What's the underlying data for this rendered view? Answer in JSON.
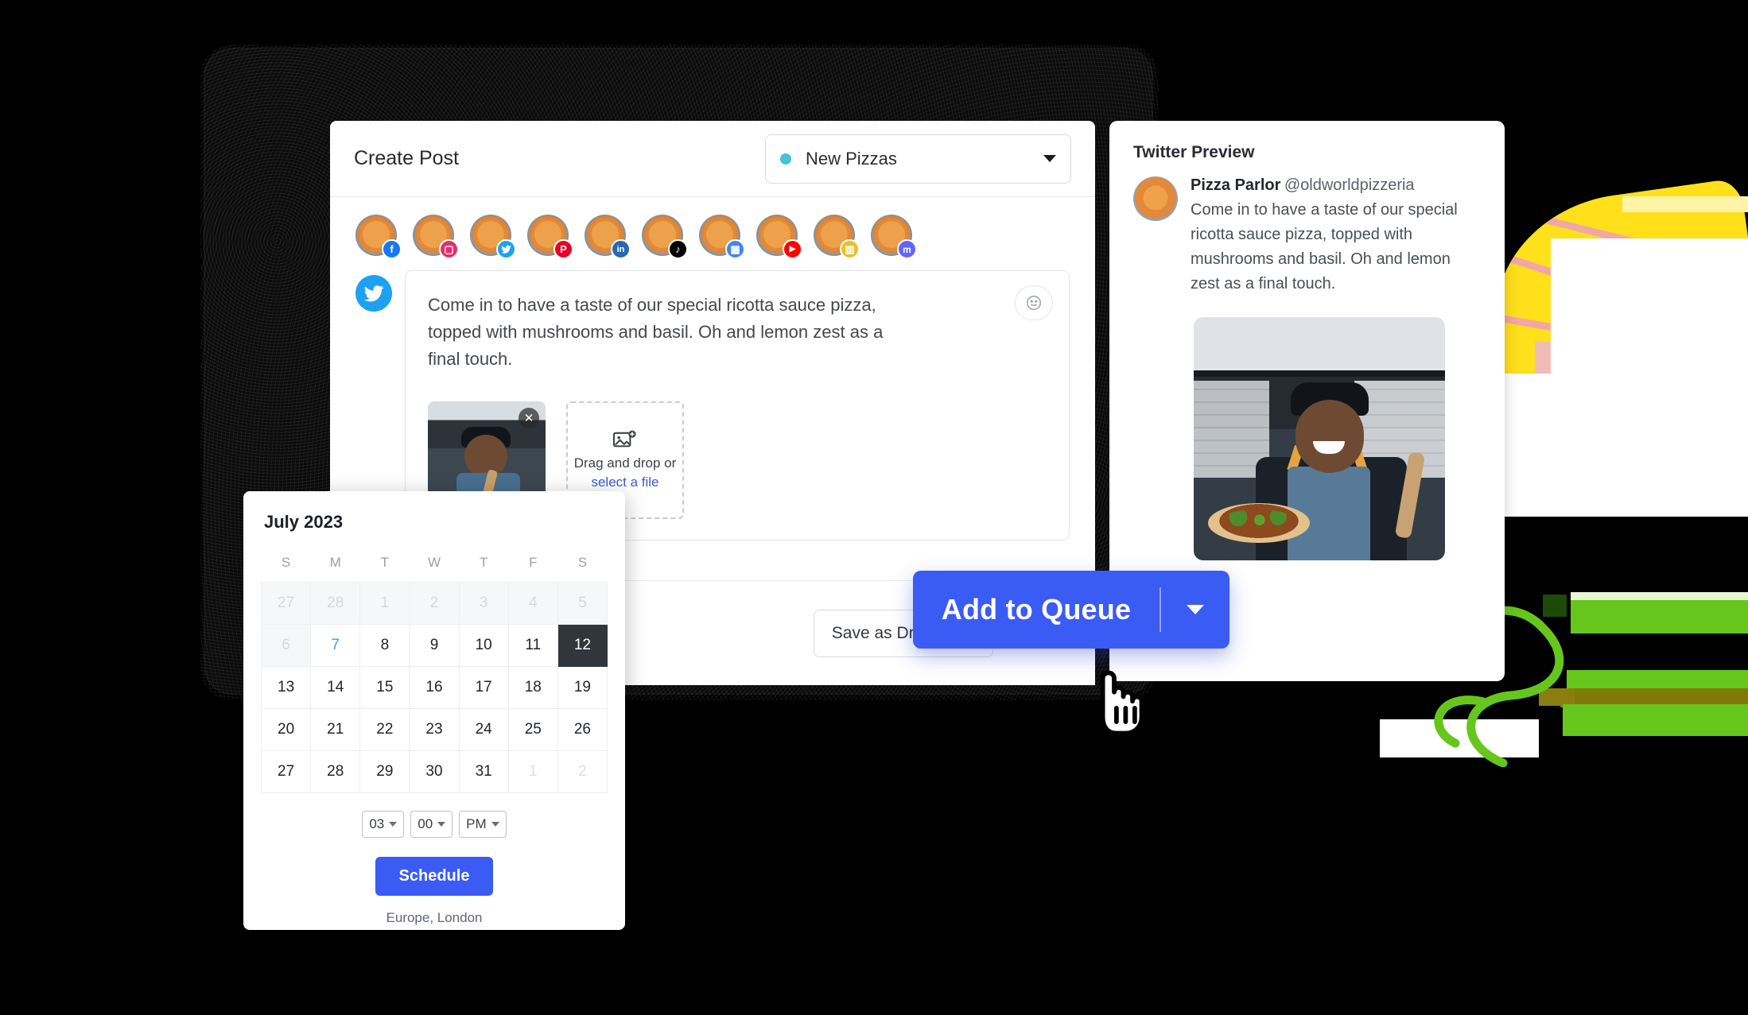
{
  "compose": {
    "title": "Create Post",
    "campaign": {
      "label": "New Pizzas",
      "dot_color": "#45c3d4"
    },
    "accounts": [
      {
        "network": "facebook",
        "badge_glyph": "f"
      },
      {
        "network": "instagram",
        "badge_glyph": "▣"
      },
      {
        "network": "twitter",
        "badge_glyph": "ᴠ"
      },
      {
        "network": "pinterest",
        "badge_glyph": "℗"
      },
      {
        "network": "linkedin",
        "badge_glyph": "in"
      },
      {
        "network": "tiktok",
        "badge_glyph": "♪"
      },
      {
        "network": "google-business",
        "badge_glyph": "▤"
      },
      {
        "network": "youtube",
        "badge_glyph": "▶"
      },
      {
        "network": "shopify",
        "badge_glyph": "▥"
      },
      {
        "network": "mastodon",
        "badge_glyph": "m"
      }
    ],
    "editor": {
      "network": "twitter",
      "text": "Come in to have a taste of our special ricotta sauce pizza, topped with mushrooms and basil. Oh and lemon zest as a final touch.",
      "emoji_button": "☺",
      "attachment_remove": "✕"
    },
    "dropzone": {
      "text": "Drag and drop or",
      "link": "select a file"
    },
    "footer": {
      "save_draft": "Save as Draft",
      "primary": "Add to Queue"
    }
  },
  "preview": {
    "title": "Twitter Preview",
    "author_name": "Pizza Parlor",
    "author_handle": "@oldworldpizzeria",
    "text": "Come in to have a taste of our special ricotta sauce pizza, topped with mushrooms and basil. Oh and lemon zest as a final touch."
  },
  "scheduler": {
    "month": "July 2023",
    "weekdays": [
      "S",
      "M",
      "T",
      "W",
      "T",
      "F",
      "S"
    ],
    "weeks": [
      [
        {
          "d": "27",
          "state": "muted"
        },
        {
          "d": "28",
          "state": "muted"
        },
        {
          "d": "1",
          "state": "muted"
        },
        {
          "d": "2",
          "state": "muted"
        },
        {
          "d": "3",
          "state": "muted"
        },
        {
          "d": "4",
          "state": "muted"
        },
        {
          "d": "5",
          "state": "muted"
        }
      ],
      [
        {
          "d": "6",
          "state": "muted"
        },
        {
          "d": "7",
          "state": "today"
        },
        {
          "d": "8",
          "state": "normal"
        },
        {
          "d": "9",
          "state": "normal"
        },
        {
          "d": "10",
          "state": "normal"
        },
        {
          "d": "11",
          "state": "normal"
        },
        {
          "d": "12",
          "state": "selected"
        }
      ],
      [
        {
          "d": "13",
          "state": "normal"
        },
        {
          "d": "14",
          "state": "normal"
        },
        {
          "d": "15",
          "state": "normal"
        },
        {
          "d": "16",
          "state": "normal"
        },
        {
          "d": "17",
          "state": "normal"
        },
        {
          "d": "18",
          "state": "normal"
        },
        {
          "d": "19",
          "state": "normal"
        }
      ],
      [
        {
          "d": "20",
          "state": "normal"
        },
        {
          "d": "21",
          "state": "normal"
        },
        {
          "d": "22",
          "state": "normal"
        },
        {
          "d": "23",
          "state": "normal"
        },
        {
          "d": "24",
          "state": "normal"
        },
        {
          "d": "25",
          "state": "normal"
        },
        {
          "d": "26",
          "state": "normal"
        }
      ],
      [
        {
          "d": "27",
          "state": "normal"
        },
        {
          "d": "28",
          "state": "normal"
        },
        {
          "d": "29",
          "state": "normal"
        },
        {
          "d": "30",
          "state": "normal"
        },
        {
          "d": "31",
          "state": "normal"
        },
        {
          "d": "1",
          "state": "outside"
        },
        {
          "d": "2",
          "state": "outside"
        }
      ]
    ],
    "time": {
      "hour": "03",
      "minute": "00",
      "meridiem": "PM"
    },
    "schedule_button": "Schedule",
    "timezone": "Europe, London"
  },
  "colors": {
    "primary": "#3b5bf5",
    "accent_teal": "#45c3d4",
    "selected_day": "#31363d",
    "today": "#4a9fe0",
    "deco_yellow": "#ffe01b",
    "deco_green": "#66c61c",
    "deco_pink": "#f3b4b4"
  }
}
